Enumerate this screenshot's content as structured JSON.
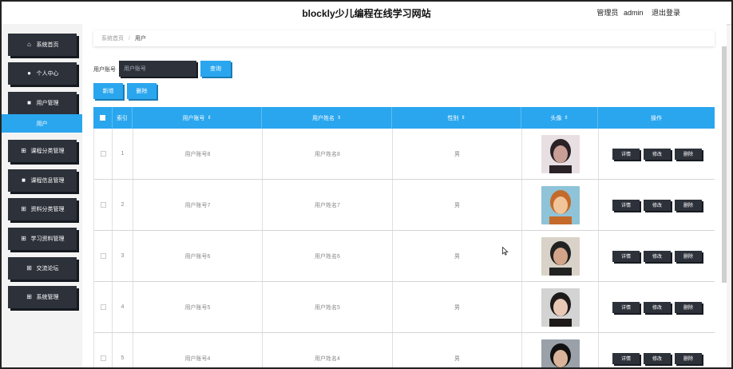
{
  "header": {
    "title": "blockly少儿编程在线学习网站",
    "role": "管理员",
    "username": "admin",
    "logout": "退出登录"
  },
  "sidebar": {
    "items": [
      {
        "label": "系统首页",
        "icon": "home-icon"
      },
      {
        "label": "个人中心",
        "icon": "user-icon"
      },
      {
        "label": "用户管理",
        "icon": "clipboard-icon"
      },
      {
        "label": "课程分类管理",
        "icon": "grid-icon"
      },
      {
        "label": "课程信息管理",
        "icon": "clipboard-icon"
      },
      {
        "label": "资料分类管理",
        "icon": "grid-icon"
      },
      {
        "label": "学习资料管理",
        "icon": "grid-icon"
      },
      {
        "label": "交流论坛",
        "icon": "grid-icon"
      },
      {
        "label": "系统管理",
        "icon": "grid-icon"
      }
    ],
    "active_sub": "用户"
  },
  "breadcrumb": {
    "home": "系统首页",
    "current": "用户"
  },
  "search": {
    "label": "用户账号",
    "placeholder": "用户账号",
    "button": "查询"
  },
  "actions": {
    "add": "新增",
    "delete": "删除"
  },
  "table": {
    "headers": {
      "index": "索引",
      "account": "用户账号",
      "name": "用户姓名",
      "gender": "性别",
      "avatar": "头像",
      "ops": "操作"
    },
    "sort_icon": "sort-icon",
    "op_labels": {
      "detail": "详情",
      "edit": "修改",
      "delete": "删除"
    },
    "rows": [
      {
        "index": "1",
        "account": "用户账号8",
        "name": "用户姓名8",
        "gender": "男"
      },
      {
        "index": "2",
        "account": "用户账号7",
        "name": "用户姓名7",
        "gender": "男"
      },
      {
        "index": "3",
        "account": "用户账号6",
        "name": "用户姓名6",
        "gender": "男"
      },
      {
        "index": "4",
        "account": "用户账号5",
        "name": "用户姓名5",
        "gender": "男"
      },
      {
        "index": "5",
        "account": "用户账号4",
        "name": "用户姓名4",
        "gender": "男"
      }
    ]
  },
  "colors": {
    "accent": "#2aa6ee",
    "dark_button": "#2c313a"
  }
}
